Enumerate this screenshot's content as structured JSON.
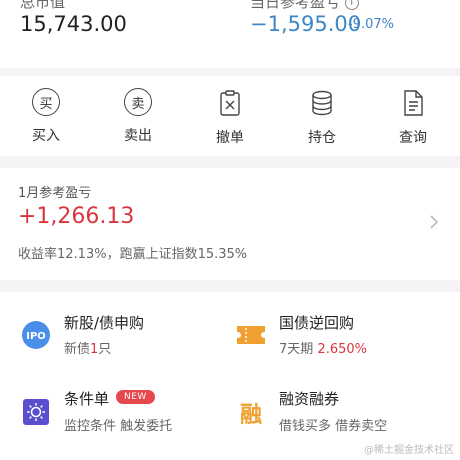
{
  "summary": {
    "market_value_label": "总市值",
    "market_value": "15,743.00",
    "daily_pnl_label": "当日参考盈亏",
    "daily_pnl": "−1,595.00",
    "daily_pnl_pct": "-9.07%"
  },
  "actions": [
    {
      "label": "买入",
      "glyph": "买"
    },
    {
      "label": "卖出",
      "glyph": "卖"
    },
    {
      "label": "撤单",
      "glyph": ""
    },
    {
      "label": "持仓",
      "glyph": ""
    },
    {
      "label": "查询",
      "glyph": ""
    }
  ],
  "monthly": {
    "title": "1月参考盈亏",
    "value": "+1,266.13",
    "desc": "收益率12.13%，跑赢上证指数15.35%"
  },
  "services": {
    "ipo": {
      "title": "新股/债申购",
      "sub_prefix": "新债",
      "sub_count": "1",
      "sub_suffix": "只",
      "icon_text": "IPO"
    },
    "repo": {
      "title": "国债逆回购",
      "sub_term": "7天期",
      "sub_rate": "2.650%"
    },
    "condition": {
      "title": "条件单",
      "badge": "NEW",
      "sub": "监控条件 触发委托"
    },
    "margin": {
      "title": "融资融券",
      "sub": "借钱买多 借券卖空",
      "icon_text": "融"
    }
  },
  "colors": {
    "red": "#d9363e",
    "blue": "#3f86c6",
    "orange": "#f0a030",
    "purple": "#5a4fcf"
  },
  "watermark": "@稀土掘金技术社区"
}
